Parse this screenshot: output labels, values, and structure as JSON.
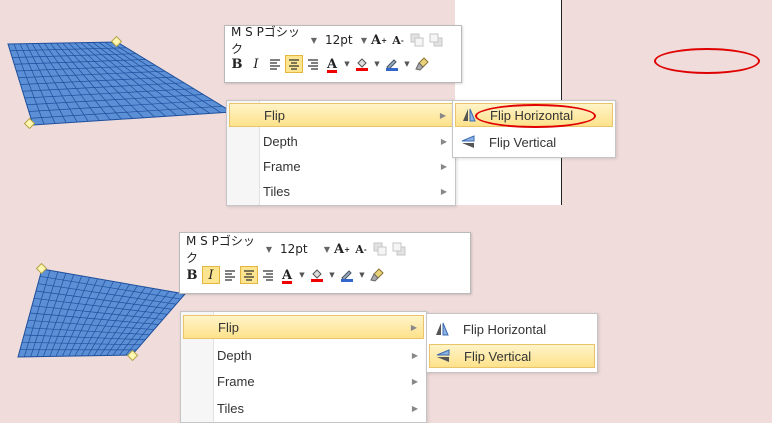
{
  "colors": {
    "background": "#efdcdb",
    "highlight": "#fde28b",
    "grid_fill": "#5b8fd6",
    "grid_line": "#1f4f9c",
    "annotation": "#e00000"
  },
  "top": {
    "toolbar": {
      "font_name": "M S Pゴシック",
      "font_size": "12pt",
      "grow_font": "A",
      "shrink_font": "A",
      "bold": "B",
      "italic": "I",
      "font_color": "A",
      "active_buttons": [
        "align-center"
      ]
    },
    "menu": {
      "items": [
        {
          "label": "Flip",
          "highlighted": true
        },
        {
          "label": "Depth",
          "highlighted": false
        },
        {
          "label": "Frame",
          "highlighted": false
        },
        {
          "label": "Tiles",
          "highlighted": false
        }
      ]
    },
    "submenu": {
      "items": [
        {
          "label": "Flip Horizontal",
          "icon": "flip-horizontal-icon",
          "highlighted": true
        },
        {
          "label": "Flip Vertical",
          "icon": "flip-vertical-icon",
          "highlighted": false
        }
      ]
    }
  },
  "bottom": {
    "toolbar": {
      "font_name": "M S Pゴシック",
      "font_size": "12pt",
      "grow_font": "A",
      "shrink_font": "A",
      "bold": "B",
      "italic": "I",
      "font_color": "A",
      "active_buttons": [
        "italic",
        "align-center"
      ]
    },
    "menu": {
      "items": [
        {
          "label": "Flip",
          "highlighted": true
        },
        {
          "label": "Depth",
          "highlighted": false
        },
        {
          "label": "Frame",
          "highlighted": false
        },
        {
          "label": "Tiles",
          "highlighted": false
        }
      ]
    },
    "submenu": {
      "items": [
        {
          "label": "Flip Horizontal",
          "icon": "flip-horizontal-icon",
          "highlighted": false
        },
        {
          "label": "Flip Vertical",
          "icon": "flip-vertical-icon",
          "highlighted": true
        }
      ]
    }
  }
}
